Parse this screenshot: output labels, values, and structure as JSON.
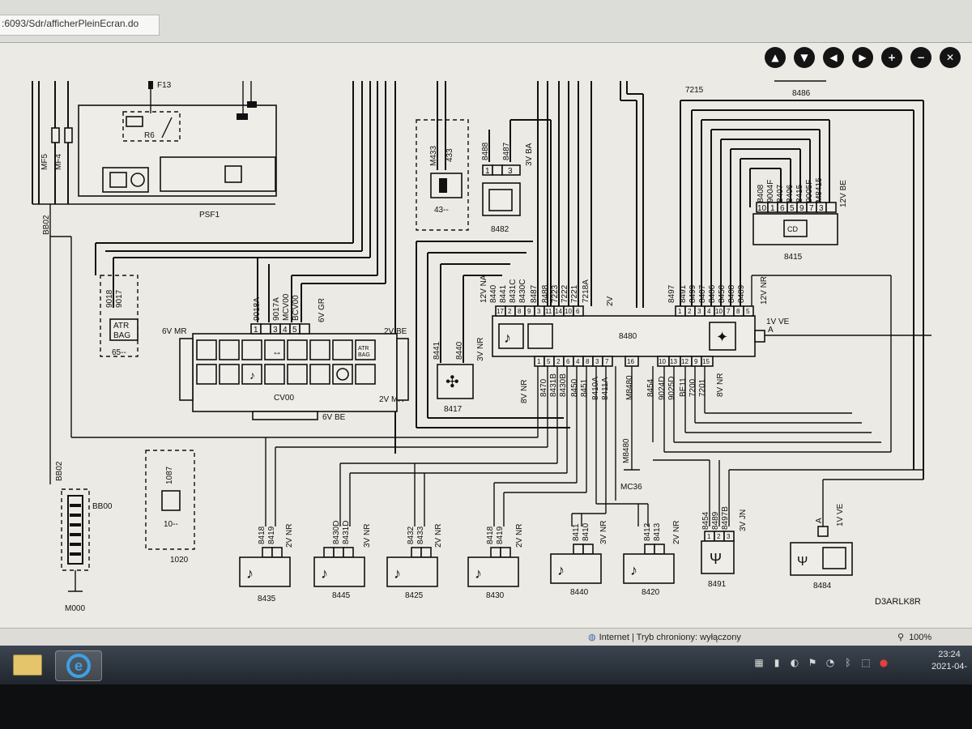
{
  "browser": {
    "address": ":6093/Sdr/afficherPleinEcran.do",
    "tab_hint": "..."
  },
  "toolbar": {
    "buttons": [
      "up",
      "down",
      "left",
      "right",
      "zoom-in",
      "zoom-out",
      "close"
    ]
  },
  "diagram": {
    "reference": "D3ARLK8R",
    "top_labels": {
      "t7215": "7215",
      "t8486": "8486",
      "tF13": "F13"
    },
    "psf1": {
      "label": "PSF1",
      "mf5": "MF5",
      "mf4": "MF4",
      "r6": "R6",
      "bb02": "BB02"
    },
    "box_433": {
      "codes": [
        "M433",
        "433"
      ],
      "label": "43--"
    },
    "box_8482": {
      "codes": [
        "8488",
        "8487"
      ],
      "pins": [
        "1",
        "3"
      ],
      "volt": "3V BA",
      "label": "8482"
    },
    "box_8415": {
      "codes": [
        "8408",
        "9004F",
        "8407",
        "8406",
        "8415",
        "9005F",
        "M8415"
      ],
      "pins": [
        "10",
        "1",
        "6",
        "5",
        "9",
        "7",
        "3"
      ],
      "volt": "12V BE",
      "label": "8415"
    },
    "box_65": {
      "codes": [
        "9018",
        "9017"
      ],
      "text": "ATR\nBAG",
      "label": "65--"
    },
    "cv00": {
      "label": "CV00",
      "top_codes": [
        "9018A",
        "9017A",
        "MCV00",
        "BCV00"
      ],
      "top_pins": [
        "1",
        "3",
        "4",
        "5"
      ],
      "v_left": "6V MR",
      "v_right": "2V BE",
      "v_top": "6V GR",
      "v_bottom": "6V BE",
      "v_right2": "2V MR"
    },
    "box_8417": {
      "codes": [
        "8441",
        "8440"
      ],
      "volt": "3V NR",
      "label": "8417"
    },
    "box_8480": {
      "label": "8480",
      "top_codes_left": [
        "12V NA",
        "8440",
        "8441",
        "8431C",
        "8430C",
        "8487",
        "8488",
        "7223",
        "7222",
        "7221",
        "7218A"
      ],
      "top_pins_left": [
        "17",
        "2",
        "8",
        "9",
        "3",
        "11",
        "14",
        "10",
        "6"
      ],
      "v_mid": "2V",
      "top_codes_right": [
        "8497",
        "8491",
        "8499",
        "8407",
        "8406",
        "8450",
        "8408",
        "8489",
        "12V NR"
      ],
      "top_pins_right": [
        "1",
        "2",
        "3",
        "4",
        "10",
        "7",
        "8",
        "5"
      ],
      "right_volt": "1V VE",
      "right_pin": "A",
      "bottom_codes_left": [
        "8V NR",
        "8470",
        "8431B",
        "8430B",
        "8450",
        "8451",
        "8410A",
        "8411A"
      ],
      "bottom_pins_left": [
        "1",
        "5",
        "2",
        "6",
        "4",
        "8",
        "3",
        "7"
      ],
      "bottom_codes_right": [
        "8454",
        "9024D",
        "9025D",
        "BE11",
        "7200",
        "7201",
        "8V NR"
      ],
      "bottom_pins_right": [
        "16",
        "10",
        "13",
        "12",
        "9",
        "15"
      ],
      "m_code": "M8480"
    },
    "box_10": {
      "code": "1087",
      "label": "10--",
      "label2": "1020"
    },
    "ground_m000": "M000",
    "ground_mc36": "MC36",
    "m8480_label": "M8480",
    "bb00": "BB00",
    "bb02b": "BB02",
    "speakers": [
      {
        "label": "8435",
        "codes": [
          "8418",
          "8419"
        ],
        "volt": "2V NR"
      },
      {
        "label": "8445",
        "codes": [
          "8430D",
          "8431D"
        ],
        "volt": "3V NR"
      },
      {
        "label": "8425",
        "codes": [
          "8432",
          "8433"
        ],
        "volt": "2V NR"
      },
      {
        "label": "8430",
        "codes": [
          "8418",
          "8419"
        ],
        "volt": "2V NR"
      },
      {
        "label": "8440",
        "codes": [
          "8411",
          "8410"
        ],
        "volt": "3V NR"
      },
      {
        "label": "8420",
        "codes": [
          "8412",
          "8413"
        ],
        "volt": "2V NR"
      }
    ],
    "box_8491": {
      "label": "8491",
      "codes": [
        "8454",
        "8489",
        "8497B"
      ],
      "pins": [
        "1",
        "2",
        "3"
      ],
      "volt": "3V JN"
    },
    "box_8484": {
      "label": "8484",
      "pin": "A",
      "volt": "1V VE"
    }
  },
  "statusbar": {
    "zone": "Internet | Tryb chroniony: wyłączony",
    "zoom": "100%"
  },
  "taskbar": {
    "time": "23:24",
    "date": "2021-04-"
  }
}
